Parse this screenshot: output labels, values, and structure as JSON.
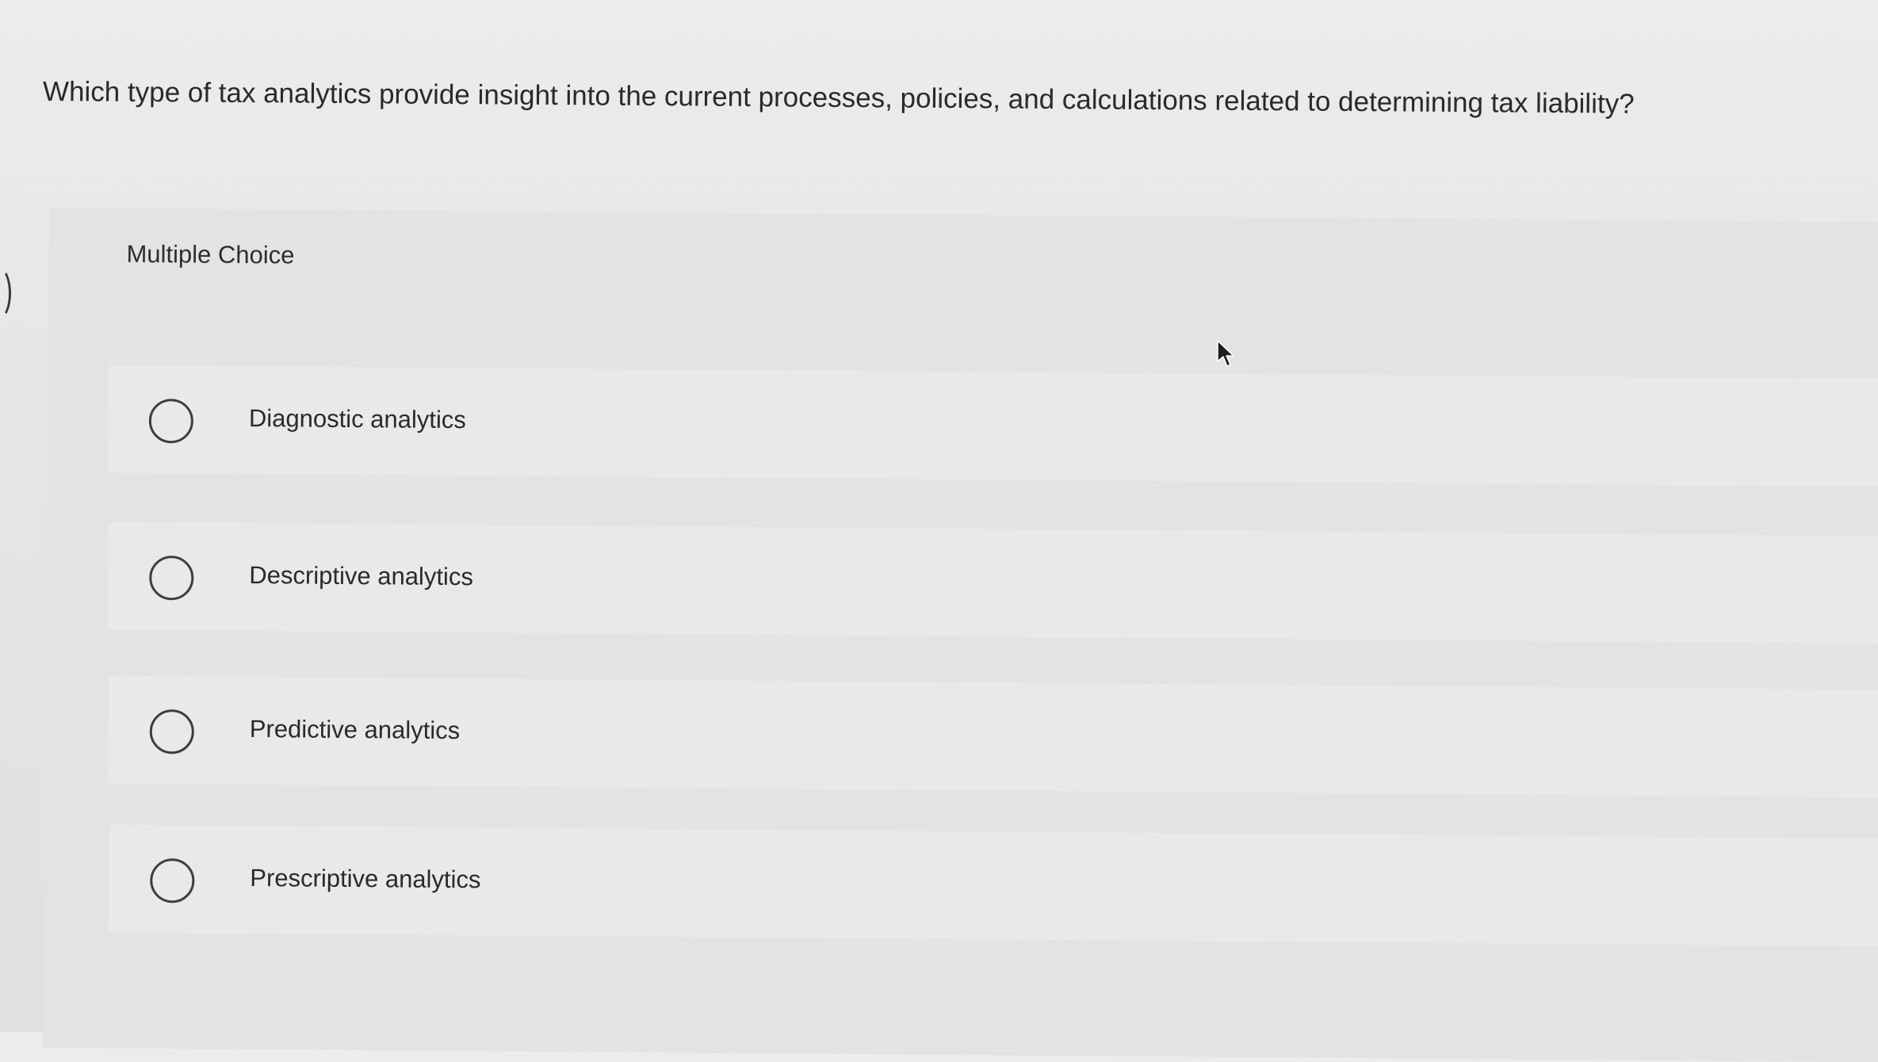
{
  "question": {
    "text": "Which type of tax analytics provide insight into the current processes, policies, and calculations related to determining tax liability?"
  },
  "panel": {
    "label": "Multiple Choice"
  },
  "options": [
    {
      "label": "Diagnostic analytics",
      "selected": false
    },
    {
      "label": "Descriptive analytics",
      "selected": false
    },
    {
      "label": "Predictive analytics",
      "selected": false
    },
    {
      "label": "Prescriptive analytics",
      "selected": false
    }
  ],
  "icons": {
    "radio": "radio-unselected-icon",
    "cursor": "mouse-pointer-icon"
  }
}
